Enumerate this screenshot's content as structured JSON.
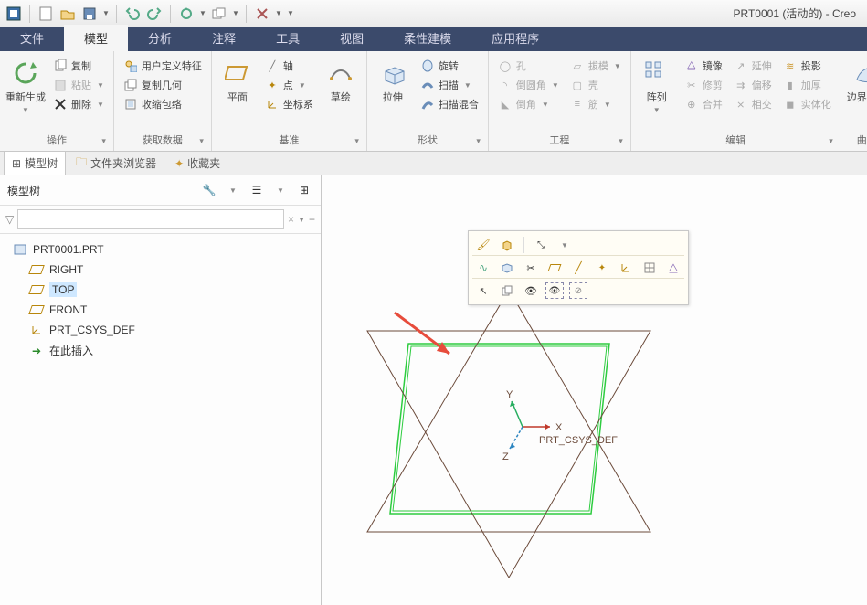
{
  "window": {
    "title": "PRT0001 (活动的) - Creo"
  },
  "qat": {
    "items": [
      "app",
      "new",
      "open",
      "save",
      "undo",
      "redo",
      "regen",
      "cut",
      "close"
    ]
  },
  "tabs": [
    "文件",
    "模型",
    "分析",
    "注释",
    "工具",
    "视图",
    "柔性建模",
    "应用程序"
  ],
  "tabs_active_index": 1,
  "ribbon": {
    "groups": [
      {
        "name": "操作",
        "big": [
          {
            "label": "重新生成",
            "icon": "regen"
          }
        ],
        "small": [
          {
            "label": "复制",
            "icon": "copy"
          },
          {
            "label": "粘贴",
            "icon": "paste",
            "caret": true,
            "disabled": true
          },
          {
            "label": "删除",
            "icon": "delete",
            "caret": true
          }
        ]
      },
      {
        "name": "获取数据",
        "small": [
          {
            "label": "用户定义特征",
            "icon": "udf"
          },
          {
            "label": "复制几何",
            "icon": "copygeom"
          },
          {
            "label": "收缩包络",
            "icon": "shrink"
          }
        ]
      },
      {
        "name": "基准",
        "big": [
          {
            "label": "平面",
            "icon": "plane"
          },
          {
            "label": "草绘",
            "icon": "sketch"
          }
        ],
        "small": [
          {
            "label": "轴",
            "icon": "axis"
          },
          {
            "label": "点",
            "icon": "point",
            "caret": true
          },
          {
            "label": "坐标系",
            "icon": "csys"
          }
        ]
      },
      {
        "name": "形状",
        "big": [
          {
            "label": "拉伸",
            "icon": "extrude"
          }
        ],
        "small": [
          {
            "label": "旋转",
            "icon": "revolve"
          },
          {
            "label": "扫描",
            "icon": "sweep",
            "caret": true
          },
          {
            "label": "扫描混合",
            "icon": "swept"
          }
        ]
      },
      {
        "name": "工程",
        "small_disabled": [
          {
            "label": "孔"
          },
          {
            "label": "倒圆角",
            "caret": true
          },
          {
            "label": "倒角",
            "caret": true
          }
        ],
        "small_disabled2": [
          {
            "label": "拔模",
            "caret": true
          },
          {
            "label": "壳"
          },
          {
            "label": "筋",
            "caret": true
          }
        ]
      },
      {
        "name": "编辑",
        "big": [
          {
            "label": "阵列",
            "icon": "pattern"
          }
        ],
        "small": [
          {
            "label": "镜像",
            "icon": "mirror"
          },
          {
            "label": "修剪",
            "icon": "trim",
            "disabled": true
          },
          {
            "label": "合并",
            "icon": "merge",
            "disabled": true
          }
        ],
        "small2": [
          {
            "label": "延伸",
            "icon": "extend",
            "disabled": true
          },
          {
            "label": "偏移",
            "icon": "offset",
            "disabled": true
          },
          {
            "label": "相交",
            "icon": "intersect",
            "disabled": true
          }
        ],
        "small3": [
          {
            "label": "投影",
            "icon": "project"
          },
          {
            "label": "加厚",
            "icon": "thicken",
            "disabled": true
          },
          {
            "label": "实体化",
            "icon": "solidify",
            "disabled": true
          }
        ]
      },
      {
        "name": "曲面",
        "big": [
          {
            "label": "边界混合",
            "icon": "boundary"
          }
        ]
      }
    ]
  },
  "side_tabs": [
    {
      "label": "模型树",
      "icon": "tree",
      "active": true
    },
    {
      "label": "文件夹浏览器",
      "icon": "folder"
    },
    {
      "label": "收藏夹",
      "icon": "fav"
    }
  ],
  "tree": {
    "title": "模型树",
    "filter_placeholder": "",
    "root": "PRT0001.PRT",
    "children": [
      {
        "label": "RIGHT",
        "icon": "plane"
      },
      {
        "label": "TOP",
        "icon": "plane",
        "selected": true
      },
      {
        "label": "FRONT",
        "icon": "plane"
      },
      {
        "label": "PRT_CSYS_DEF",
        "icon": "csys"
      },
      {
        "label": "在此插入",
        "icon": "insert"
      }
    ]
  },
  "canvas": {
    "csys_label": "PRT_CSYS_DEF",
    "axes": {
      "x": "X",
      "y": "Y",
      "z": "Z"
    }
  }
}
